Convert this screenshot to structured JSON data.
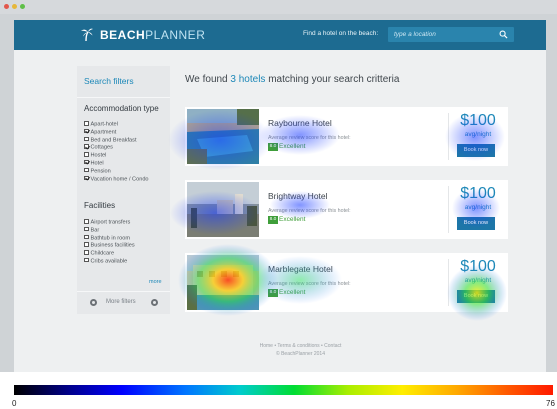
{
  "app": {
    "brand_primary": "BEACH",
    "brand_secondary": "PLANNER",
    "logo_icon": "palm-tree-icon",
    "accent_color": "#1d6b91"
  },
  "header": {
    "find_label": "Find a hotel on the beach:",
    "search_placeholder": "type a location",
    "search_icon": "search-icon"
  },
  "sidebar": {
    "title": "Search filters",
    "accommodation": {
      "heading": "Accommodation type",
      "items": [
        {
          "label": "Apart-hotel",
          "checked": false
        },
        {
          "label": "Apartment",
          "checked": true
        },
        {
          "label": "Bed and Breakfast",
          "checked": false
        },
        {
          "label": "Cottages",
          "checked": true
        },
        {
          "label": "Hostel",
          "checked": false
        },
        {
          "label": "Hotel",
          "checked": true
        },
        {
          "label": "Pension",
          "checked": false
        },
        {
          "label": "Vacation home / Condo",
          "checked": true
        }
      ]
    },
    "facilities": {
      "heading": "Facilities",
      "items": [
        {
          "label": "Airport transfers",
          "checked": false
        },
        {
          "label": "Bar",
          "checked": false
        },
        {
          "label": "Bathtub in room",
          "checked": false
        },
        {
          "label": "Business facilities",
          "checked": false
        },
        {
          "label": "Childcare",
          "checked": false
        },
        {
          "label": "Cribs available",
          "checked": false
        }
      ],
      "more_label": "more"
    },
    "more_filters": "More filters"
  },
  "results": {
    "prefix": "We found ",
    "count": "3 hotels",
    "suffix": " matching your search critteria",
    "hotels": [
      {
        "name": "Raybourne Hotel",
        "review": "Average review score for this hotel:",
        "score": "8.0",
        "rating": "Excellent",
        "price": "$100",
        "per": "avg/night",
        "button": "Book now"
      },
      {
        "name": "Brightway Hotel",
        "review": "Average review score for this hotel:",
        "score": "8.0",
        "rating": "Excellent",
        "price": "$100",
        "per": "avg/night",
        "button": "Book now"
      },
      {
        "name": "Marblegate Hotel",
        "review": "Average review score for this hotel:",
        "score": "8.0",
        "rating": "Excellent",
        "price": "$100",
        "per": "avg/night",
        "button": "Book now"
      }
    ]
  },
  "footer": {
    "links": "Home • Terms & conditions • Contact",
    "copyright": "© BeachPlanner 2014"
  },
  "scale": {
    "min": "0",
    "max": "76"
  }
}
